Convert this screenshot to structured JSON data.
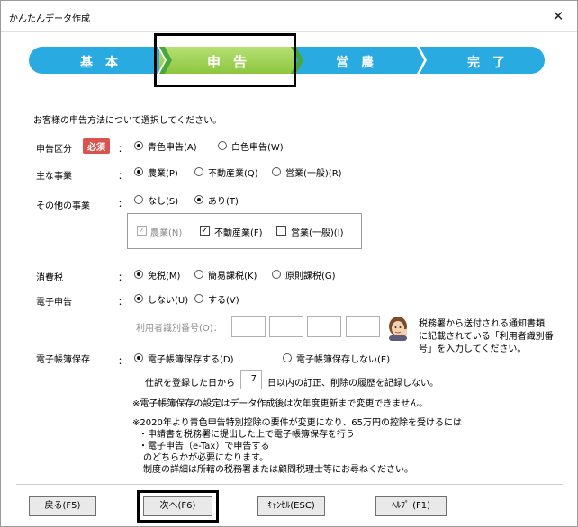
{
  "window": {
    "title": "かんたんデータ作成",
    "close_glyph": "✕"
  },
  "steps": [
    {
      "label": "基本"
    },
    {
      "label": "申告"
    },
    {
      "label": "営農"
    },
    {
      "label": "完了"
    }
  ],
  "intro": "お客様の申告方法について選択してください。",
  "filing_type": {
    "label": "申告区分",
    "required": "必須",
    "colon": "：",
    "options": [
      "青色申告(A)",
      "白色申告(W)"
    ],
    "selected": 0
  },
  "main_business": {
    "label": "主な事業",
    "colon": "：",
    "options": [
      "農業(P)",
      "不動産業(Q)",
      "営業(一般)(R)"
    ],
    "selected": 0
  },
  "other_business": {
    "label": "その他の事業",
    "colon": "：",
    "options": [
      "なし(S)",
      "あり(T)"
    ],
    "selected": 1,
    "checkboxes": [
      {
        "label": "農業(N)",
        "checked": true,
        "disabled": true
      },
      {
        "label": "不動産業(F)",
        "checked": true,
        "disabled": false
      },
      {
        "label": "営業(一般)(I)",
        "checked": false,
        "disabled": false
      }
    ]
  },
  "consumption_tax": {
    "label": "消費税",
    "colon": "：",
    "options": [
      "免税(M)",
      "簡易課税(K)",
      "原則課税(G)"
    ],
    "selected": 0
  },
  "e_filing": {
    "label": "電子申告",
    "colon": "：",
    "options": [
      "しない(U)",
      "する(V)"
    ],
    "selected": 0,
    "user_id_label": "利用者識別番号(O)：",
    "hint": [
      "税務署から送付される通知書類",
      "に記載されている「利用者識別番",
      "号」を入力してください。"
    ]
  },
  "e_books": {
    "label": "電子帳簿保存",
    "colon": "：",
    "options": [
      "電子帳簿保存する(D)",
      "電子帳簿保存しない(E)"
    ],
    "selected": 0,
    "days_prefix": "仕訳を登録した日から",
    "days_value": "7",
    "days_suffix": "日以内の訂正、削除の履歴を記録しない。",
    "note1": "※電子帳簿保存の設定はデータ作成後は次年度更新まで変更できません。",
    "note2": [
      "※2020年より青色申告特別控除の要件が変更になり、65万円の控除を受けるには",
      "・申請書を税務署に提出した上で電子帳簿保存を行う",
      "・電子申告（e-Tax）で申告する",
      "のどちらかが必要になります。",
      "制度の詳細は所轄の税務署または顧問税理士等にお尋ねください。"
    ]
  },
  "buttons": {
    "back": "戻る(F5)",
    "next": "次へ(F6)",
    "cancel": "ｷｬﾝｾﾙ(ESC)",
    "help": "ﾍﾙﾌﾟ (F1)"
  },
  "icons": {
    "advisor": "advisor-icon"
  },
  "colors": {
    "step_blue": "#29abe2",
    "step_green": "#8dc63f",
    "required_red": "#d9534f"
  }
}
